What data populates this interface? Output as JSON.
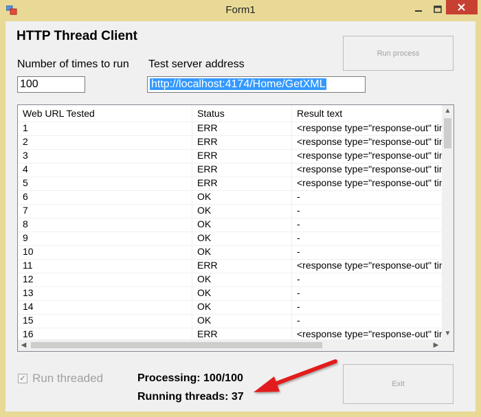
{
  "window": {
    "title": "Form1",
    "accent_colors": {
      "frame": "#e8d996",
      "close": "#c84031",
      "selection": "#3399ff",
      "callout_arrow": "#e21b1b"
    }
  },
  "form": {
    "heading": "HTTP Thread Client",
    "times_label": "Number of times to run",
    "times_value": "100",
    "address_label": "Test server address",
    "address_value": "http://localhost:4174/Home/GetXML",
    "run_button": "Run process",
    "exit_button": "Exit",
    "threaded_label": "Run threaded",
    "threaded_checked": true
  },
  "grid": {
    "columns": [
      "Web URL Tested",
      "Status",
      "Result text"
    ],
    "rows": [
      [
        "1",
        "ERR",
        "<response type=\"response-out\" time"
      ],
      [
        "2",
        "ERR",
        "<response type=\"response-out\" time"
      ],
      [
        "3",
        "ERR",
        "<response type=\"response-out\" time"
      ],
      [
        "4",
        "ERR",
        "<response type=\"response-out\" time"
      ],
      [
        "5",
        "ERR",
        "<response type=\"response-out\" time"
      ],
      [
        "6",
        "OK",
        "-"
      ],
      [
        "7",
        "OK",
        "-"
      ],
      [
        "8",
        "OK",
        "-"
      ],
      [
        "9",
        "OK",
        "-"
      ],
      [
        "10",
        "OK",
        "-"
      ],
      [
        "11",
        "ERR",
        "<response type=\"response-out\" time"
      ],
      [
        "12",
        "OK",
        "-"
      ],
      [
        "13",
        "OK",
        "-"
      ],
      [
        "14",
        "OK",
        "-"
      ],
      [
        "15",
        "OK",
        "-"
      ],
      [
        "16",
        "ERR",
        "<response type=\"response-out\" time"
      ]
    ]
  },
  "status": {
    "processing": "Processing: 100/100",
    "running_threads": "Running threads: 37"
  }
}
